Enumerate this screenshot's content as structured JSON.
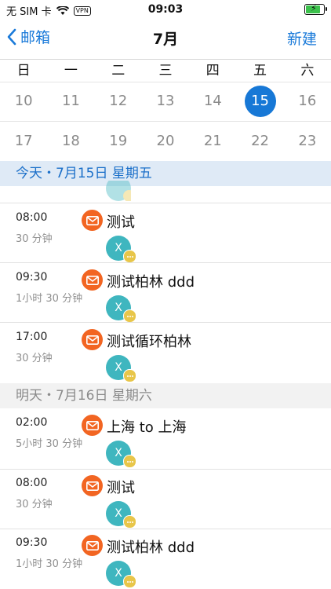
{
  "status_bar": {
    "carrier": "无 SIM 卡",
    "vpn": "VPN",
    "time": "09:03"
  },
  "nav": {
    "back_label": "邮箱",
    "title": "7月",
    "new_label": "新建"
  },
  "calendar": {
    "weekdays": [
      "日",
      "一",
      "二",
      "三",
      "四",
      "五",
      "六"
    ],
    "week1": [
      "10",
      "11",
      "12",
      "13",
      "14",
      "15",
      "16"
    ],
    "week2": [
      "17",
      "18",
      "19",
      "20",
      "21",
      "22",
      "23"
    ],
    "selected_day": "15"
  },
  "sections": {
    "today": "今天・7月15日 星期五",
    "tomorrow": "明天・7月16日 星期六"
  },
  "events": [
    {
      "time": "08:00",
      "duration": "30 分钟",
      "subject": "测试",
      "avatar": "X"
    },
    {
      "time": "09:30",
      "duration": "1小时 30 分钟",
      "subject": "测试柏林 ddd",
      "avatar": "X"
    },
    {
      "time": "17:00",
      "duration": "30 分钟",
      "subject": "测试循环柏林",
      "avatar": "X"
    },
    {
      "time": "02:00",
      "duration": "5小时 30 分钟",
      "subject": "上海 to 上海",
      "avatar": "X"
    },
    {
      "time": "08:00",
      "duration": "30 分钟",
      "subject": "测试",
      "avatar": "X"
    },
    {
      "time": "09:30",
      "duration": "1小时 30 分钟",
      "subject": "测试柏林 ddd",
      "avatar": "X"
    }
  ],
  "colors": {
    "accent": "#1a7ad9",
    "mail_icon": "#f26522",
    "avatar": "#3fb6bf",
    "badge": "#e8c64a"
  }
}
